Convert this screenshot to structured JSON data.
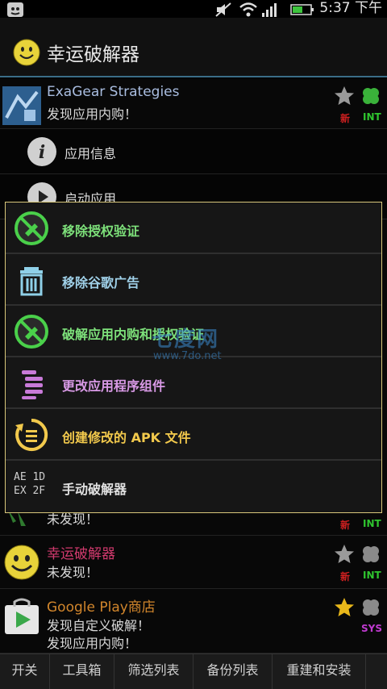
{
  "status_bar": {
    "time": "5:37 下午"
  },
  "header": {
    "title": "幸运破解器"
  },
  "apps": [
    {
      "name": "ExaGear Strategies",
      "name_color": "#a9bde0",
      "subtitle": "发现应用内购！",
      "badge": "新",
      "badge_color": "#d02020",
      "type": "INT",
      "type_color": "#2fc62f"
    },
    {
      "subtitle": "未发现！",
      "badge": "新",
      "badge_color": "#d02020",
      "type": "INT",
      "type_color": "#2fc62f"
    },
    {
      "name": "幸运破解器",
      "name_color": "#d23a6e",
      "subtitle": "未发现！",
      "badge": "新",
      "badge_color": "#d02020",
      "type": "INT",
      "type_color": "#2fc62f"
    },
    {
      "name": "Google Play商店",
      "name_color": "#d2862c",
      "subtitle": "发现自定义破解！",
      "subtitle2": "发现应用内购！",
      "type": "SYS",
      "type_color": "#c03ad0"
    }
  ],
  "app_actions": {
    "info": "应用信息",
    "launch": "启动应用"
  },
  "popup_menu": [
    {
      "label": "移除授权验证",
      "color": "#7de07a",
      "icon": "no-license-icon"
    },
    {
      "label": "移除谷歌广告",
      "color": "#9fd0e8",
      "icon": "trash-icon"
    },
    {
      "label": "破解应用内购和授权验证",
      "color": "#7de07a",
      "icon": "no-license-icon"
    },
    {
      "label": "更改应用程序组件",
      "color": "#d99ae6",
      "icon": "components-icon"
    },
    {
      "label": "创建修改的 APK 文件",
      "color": "#f2c94c",
      "icon": "rebuild-icon"
    },
    {
      "label": "手动破解器",
      "color": "#e0e0e0",
      "icon": "hex-patch-icon",
      "icon_text": [
        "AE 1D",
        "EX 2F"
      ]
    }
  ],
  "tabs": [
    {
      "label": "开关"
    },
    {
      "label": "工具箱"
    },
    {
      "label": "筛选列表"
    },
    {
      "label": "备份列表"
    },
    {
      "label": "重建和安装"
    }
  ],
  "watermark": {
    "line1": "七度网",
    "line2": "www.7do.net"
  }
}
